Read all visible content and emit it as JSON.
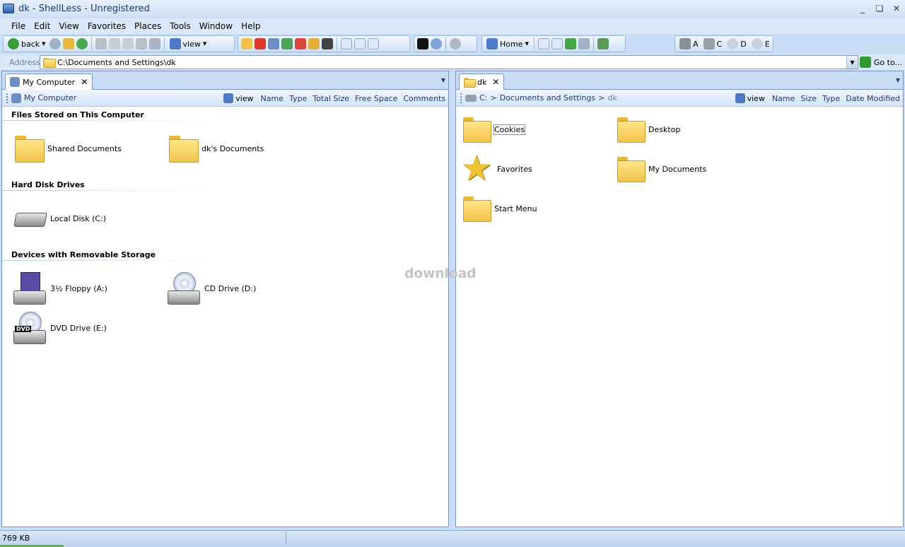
{
  "window": {
    "title": "dk - ShellLess - Unregistered",
    "controls": [
      "_",
      "❏",
      "✕"
    ]
  },
  "menu": [
    "File",
    "Edit",
    "View",
    "Favorites",
    "Places",
    "Tools",
    "Window",
    "Help"
  ],
  "toolbar": {
    "back_label": "back",
    "view_label": "view",
    "home_label": "Home",
    "drives": [
      "A",
      "C",
      "D",
      "E"
    ]
  },
  "address": {
    "label": "Address",
    "value": "C:\\Documents and Settings\\dk",
    "go_label": "Go to..."
  },
  "left_pane": {
    "tab_label": "My Computer",
    "crumb": "My Computer",
    "view_label": "view",
    "columns": [
      "Name",
      "Type",
      "Total Size",
      "Free Space",
      "Comments"
    ],
    "groups": [
      {
        "heading": "Files Stored on This Computer",
        "items": [
          "Shared Documents",
          "dk's Documents"
        ]
      },
      {
        "heading": "Hard Disk Drives",
        "items": [
          "Local Disk (C:)"
        ]
      },
      {
        "heading": "Devices with Removable Storage",
        "items": [
          "3½ Floppy (A:)",
          "CD Drive (D:)",
          "DVD Drive (E:)"
        ]
      }
    ]
  },
  "right_pane": {
    "tab_label": "dk",
    "crumb_parts": [
      "C:",
      ">",
      "Documents and Settings",
      ">",
      "dk"
    ],
    "view_label": "view",
    "columns": [
      "Name",
      "Size",
      "Type",
      "Date Modified"
    ],
    "items": [
      "Cookies",
      "Desktop",
      "Favorites",
      "My Documents",
      "Start Menu"
    ]
  },
  "watermark": "download",
  "status": {
    "size": "769 KB",
    "progress": 0.07
  },
  "colors": {
    "folder": "#f1c44c",
    "accent": "#c9ddf6",
    "green_go": "#2f9a2f"
  }
}
